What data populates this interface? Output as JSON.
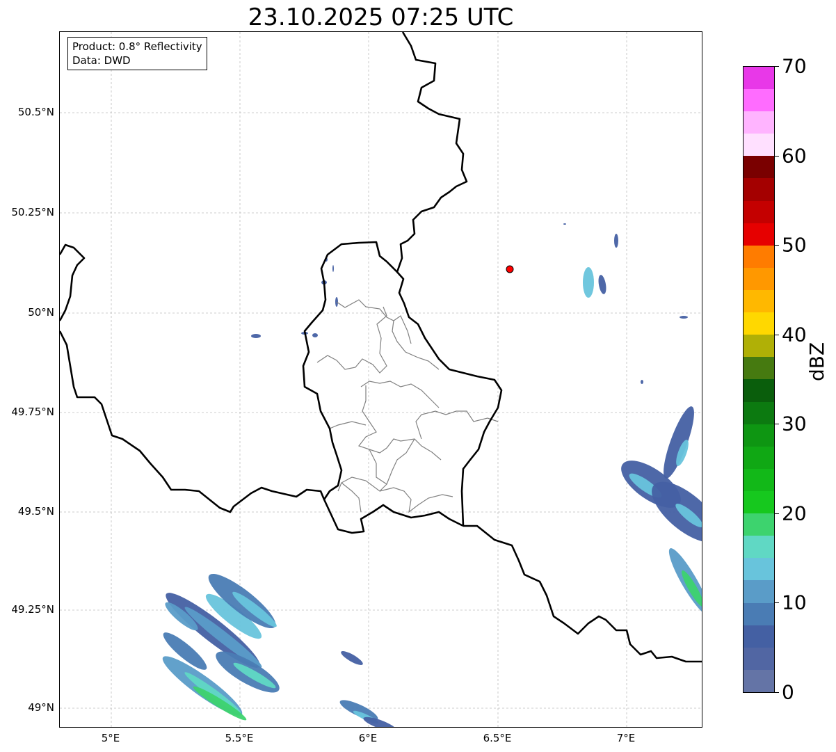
{
  "title": "23.10.2025 07:25 UTC",
  "info": {
    "product": "Product: 0.8° Reflectivity",
    "data": "Data: DWD"
  },
  "lat_labels": [
    "50.5°N",
    "50.25°N",
    "50°N",
    "49.75°N",
    "49.5°N",
    "49.25°N",
    "49°N"
  ],
  "lon_labels": [
    "5°E",
    "5.5°E",
    "6°E",
    "6.5°E",
    "7°E"
  ],
  "colorbar": {
    "unit": "dBZ",
    "tick_labels": [
      "0",
      "10",
      "20",
      "30",
      "40",
      "50",
      "60",
      "70"
    ],
    "colors": [
      "#6474a6",
      "#5166a3",
      "#4460a3",
      "#4a7cb4",
      "#5a9cc8",
      "#68c4dc",
      "#60d8c4",
      "#3dd36e",
      "#16c81e",
      "#12b818",
      "#10a814",
      "#0e9612",
      "#0c7a10",
      "#0a5e0c",
      "#467a10",
      "#b0b006",
      "#ffd800",
      "#ffb800",
      "#ff9800",
      "#ff7c00",
      "#e60000",
      "#c40000",
      "#a40000",
      "#7a0000",
      "#ffe0ff",
      "#ffb4ff",
      "#ff6cff",
      "#e838e8"
    ]
  },
  "radar_marker_color": "#ff0000"
}
